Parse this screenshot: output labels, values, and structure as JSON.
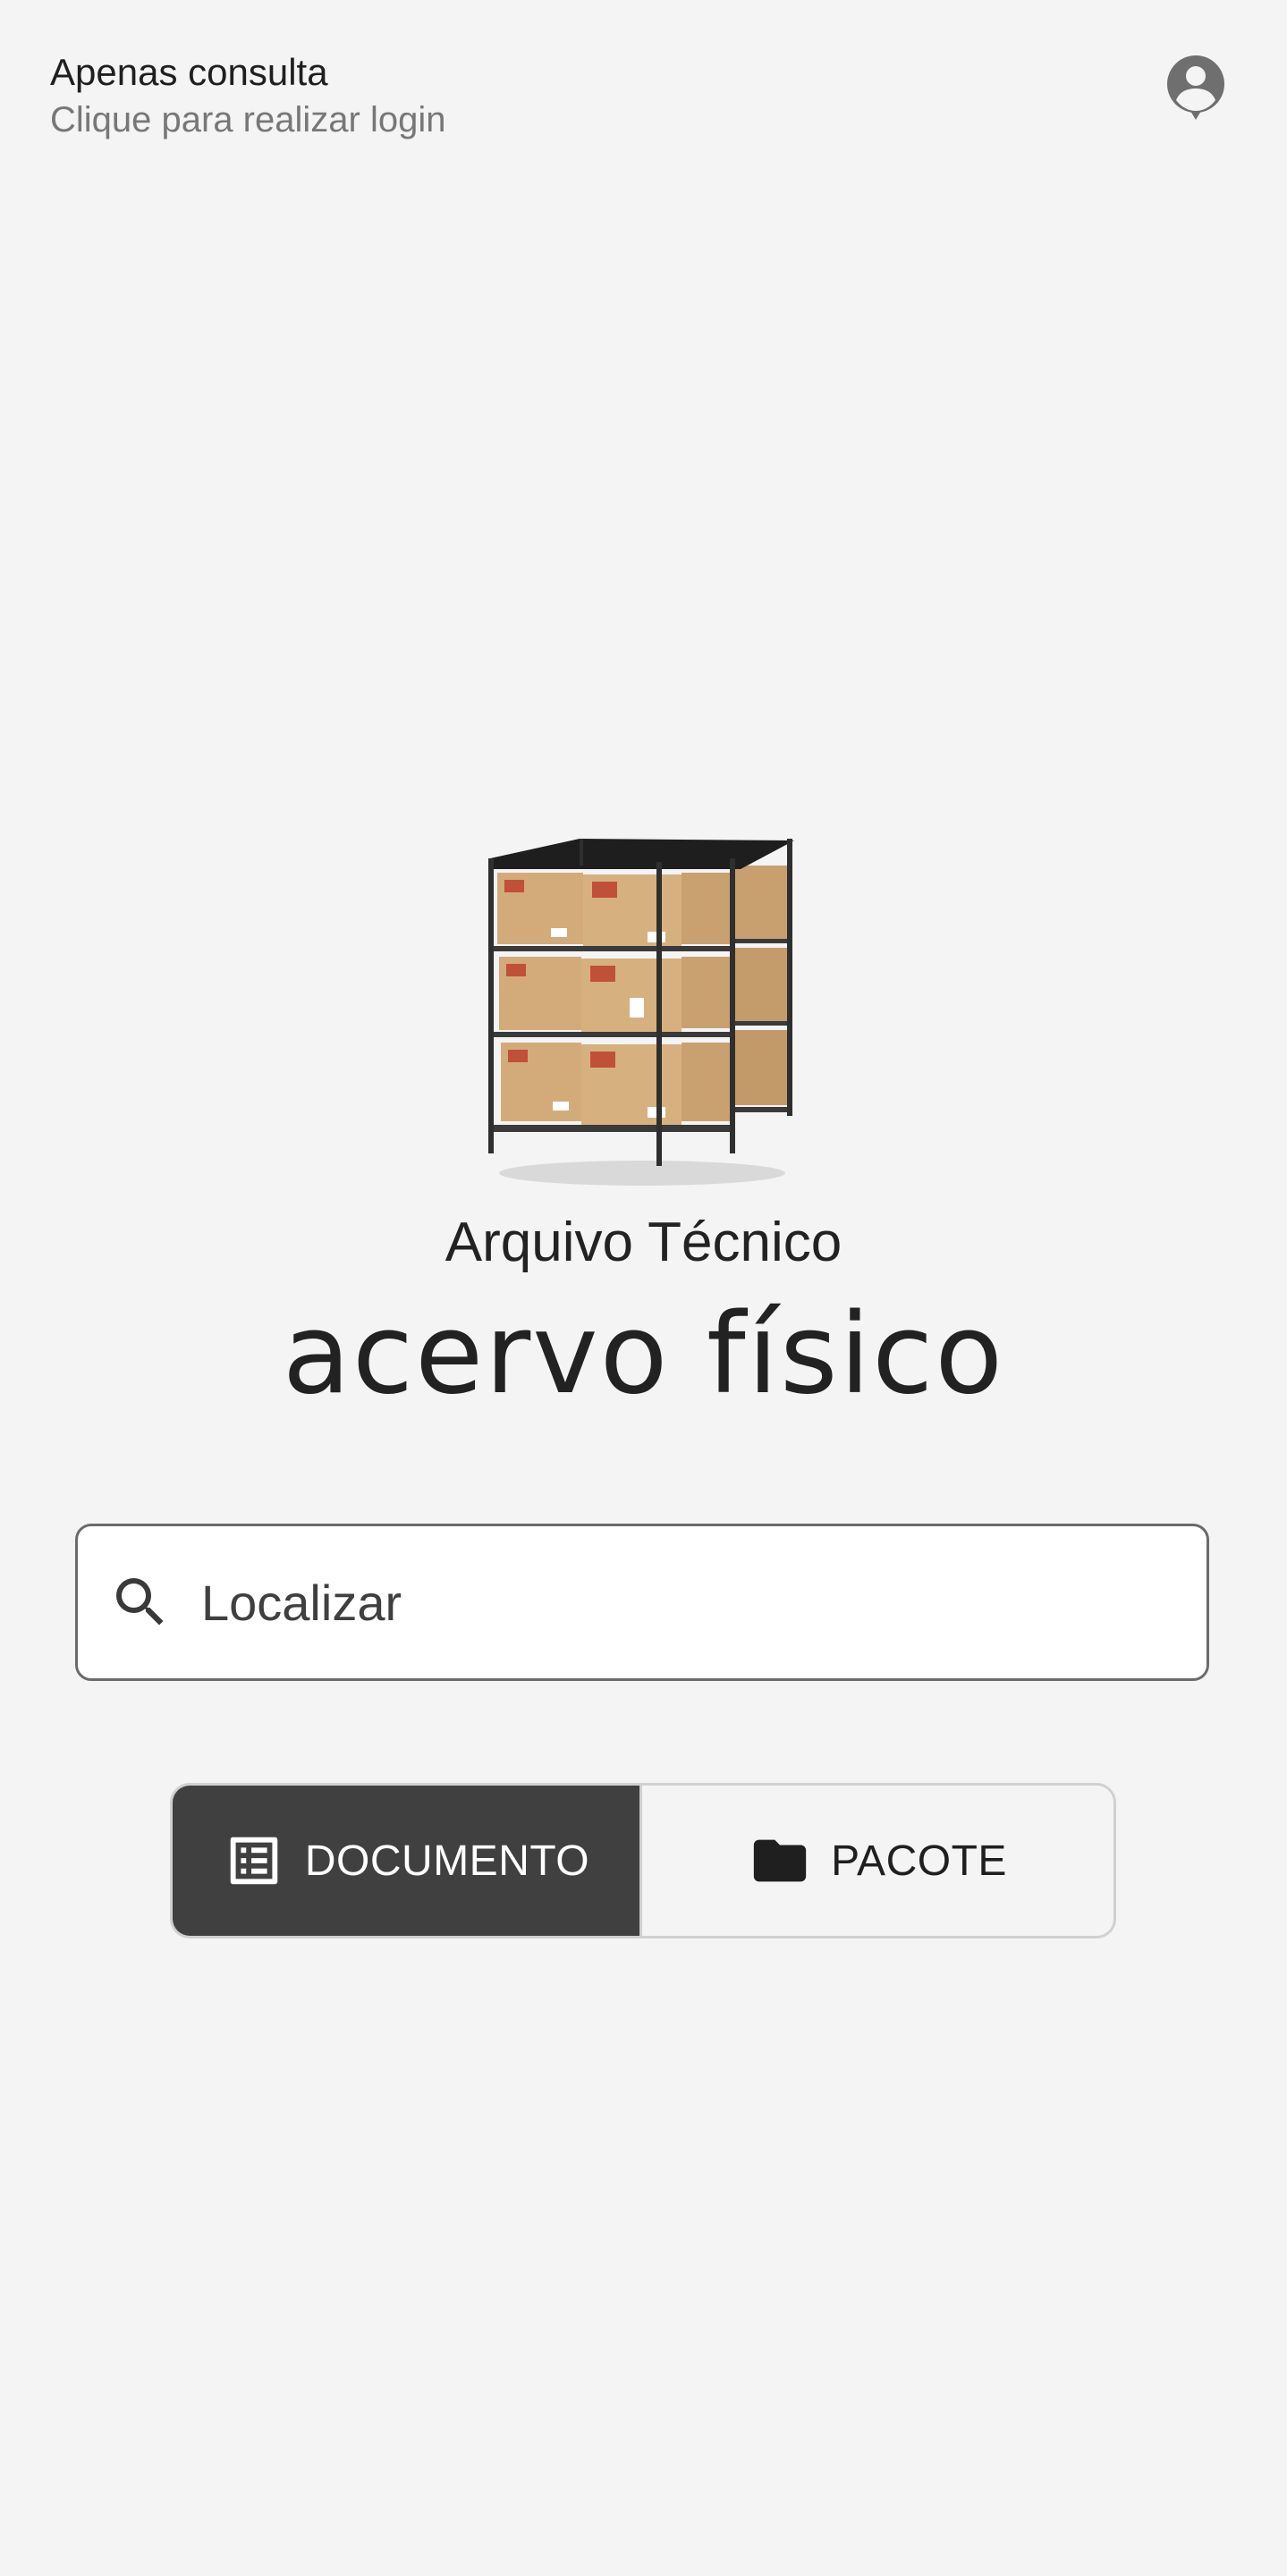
{
  "header": {
    "title": "Apenas consulta",
    "subtitle": "Clique para realizar login",
    "account_icon": "account-circle-icon"
  },
  "hero": {
    "image": "storage-shelf-with-boxes",
    "subtitle": "Arquivo Técnico",
    "title": "acervo físico"
  },
  "search": {
    "icon": "search-icon",
    "placeholder": "Localizar",
    "value": ""
  },
  "mode_toggle": {
    "options": [
      {
        "label": "DOCUMENTO",
        "icon": "document-list-icon",
        "selected": true
      },
      {
        "label": "PACOTE",
        "icon": "folder-icon",
        "selected": false
      }
    ]
  },
  "colors": {
    "background": "#f4f4f4",
    "selected_segment": "#404040",
    "text_primary": "#1f1f1f",
    "text_secondary": "#777777",
    "border": "#6b6b6b"
  }
}
